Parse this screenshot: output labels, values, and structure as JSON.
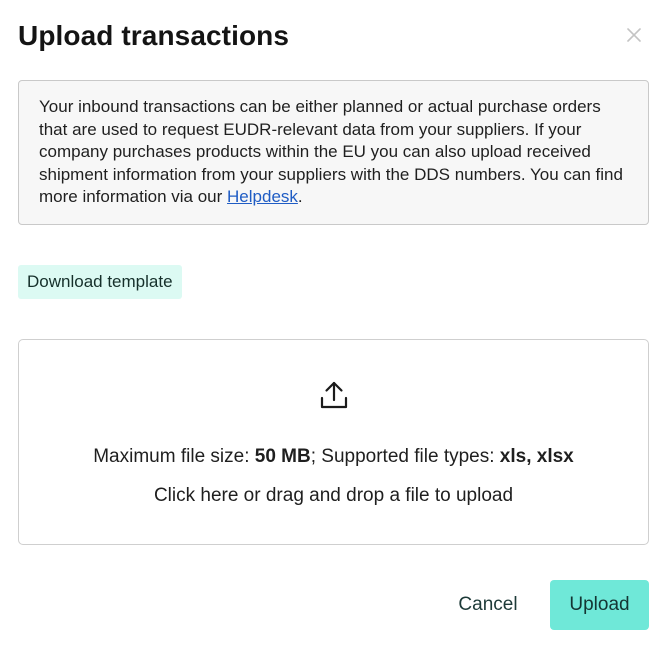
{
  "dialog": {
    "title": "Upload transactions",
    "close_icon": "close-icon"
  },
  "info": {
    "text_before_link": "Your inbound transactions can be either planned or actual purchase orders that are used to request EUDR-relevant data from your suppliers. If your company purchases products within the EU you can also upload received shipment information from your suppliers with the DDS numbers. You can find more information via our ",
    "link_label": "Helpdesk",
    "text_after_link": "."
  },
  "download": {
    "label": "Download template"
  },
  "dropzone": {
    "icon": "upload-icon",
    "max_size_label": "Maximum file size: ",
    "max_size_value": "50 MB",
    "types_label": "; Supported file types: ",
    "types_value": "xls, xlsx",
    "hint": "Click here or drag and drop a file to upload"
  },
  "actions": {
    "cancel_label": "Cancel",
    "upload_label": "Upload"
  },
  "colors": {
    "accent": "#6fe8d8",
    "download_bg": "#dcfaf3",
    "link": "#1f5cc4"
  }
}
